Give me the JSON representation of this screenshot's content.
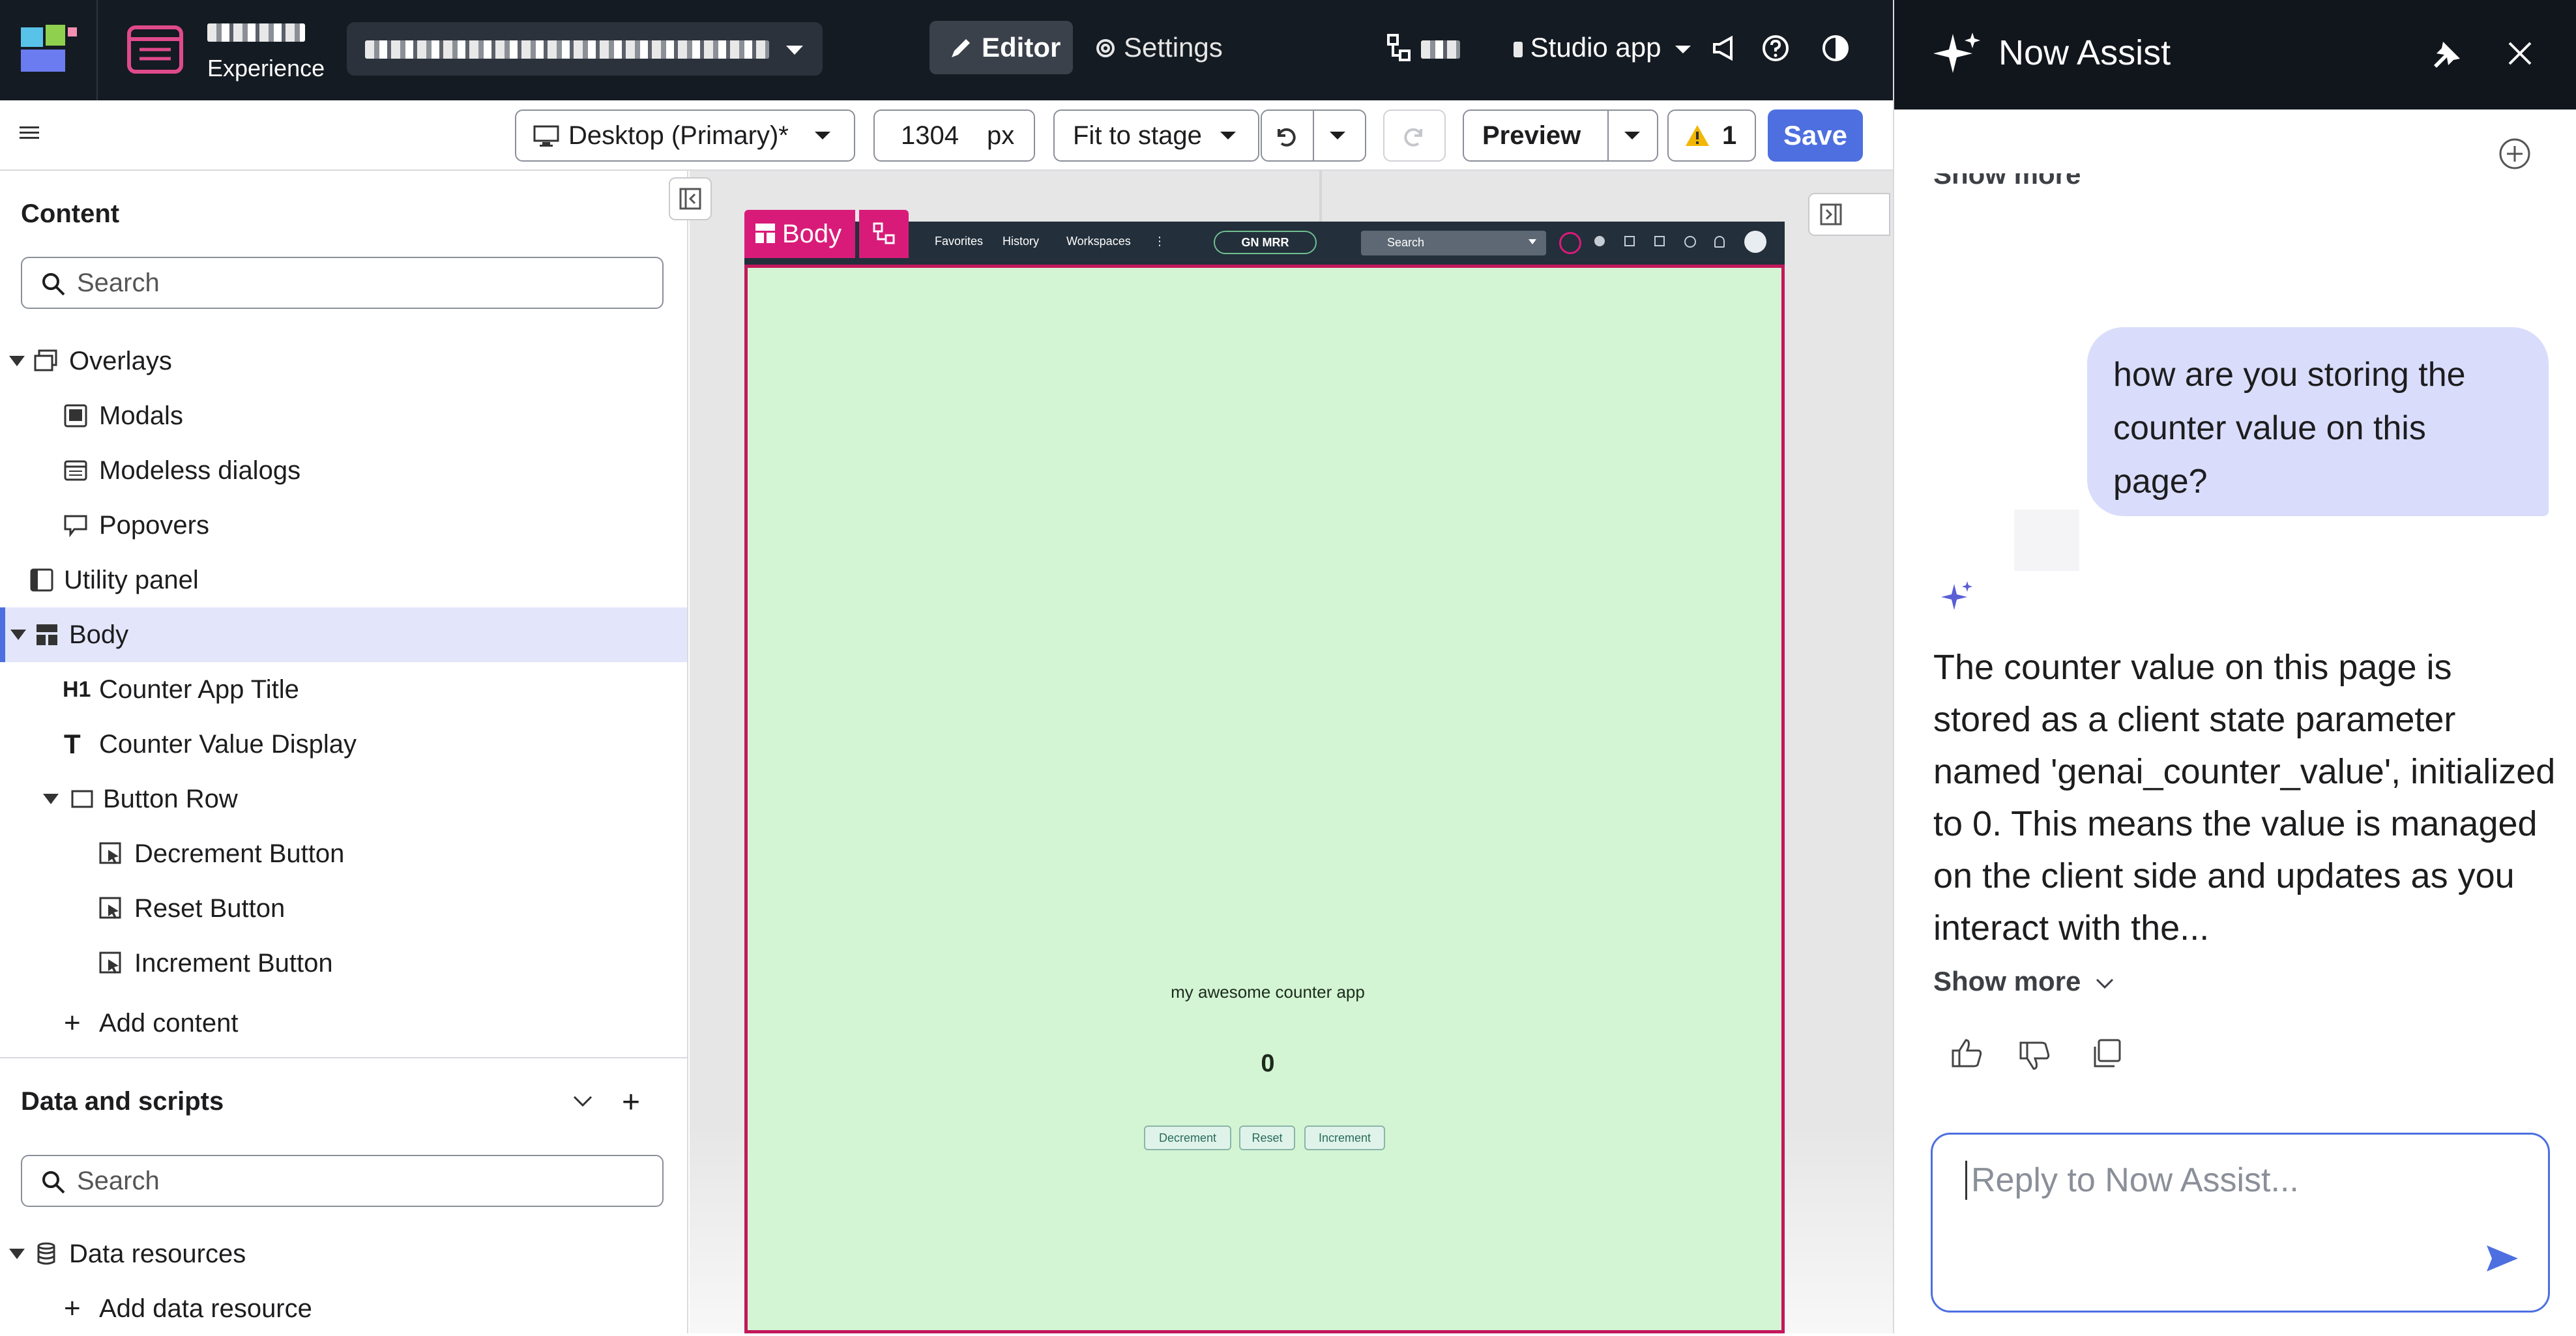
{
  "topbar": {
    "experience_label": "Experience",
    "editor_tab": "Editor",
    "settings_tab": "Settings",
    "studio_app": "Studio app"
  },
  "toolbar": {
    "viewport": "Desktop (Primary)*",
    "width_value": "1304",
    "width_unit": "px",
    "fit": "Fit to stage",
    "preview": "Preview",
    "warnings": "1",
    "save": "Save"
  },
  "content_panel": {
    "title": "Content",
    "search_placeholder": "Search",
    "tree": [
      {
        "label": "Overlays"
      },
      {
        "label": "Modals"
      },
      {
        "label": "Modeless dialogs"
      },
      {
        "label": "Popovers"
      },
      {
        "label": "Utility panel"
      },
      {
        "label": "Body"
      },
      {
        "label": "Counter App Title"
      },
      {
        "label": "Counter Value Display"
      },
      {
        "label": "Button Row"
      },
      {
        "label": "Decrement Button"
      },
      {
        "label": "Reset Button"
      },
      {
        "label": "Increment Button"
      }
    ],
    "add_content": "Add content"
  },
  "data_panel": {
    "title": "Data and scripts",
    "search_placeholder": "Search",
    "data_resources": "Data resources",
    "add_data_resource": "Add data resource"
  },
  "stage": {
    "body_tag": "Body",
    "nav_favorites": "Favorites",
    "nav_history": "History",
    "nav_workspaces": "Workspaces",
    "nav_badge": "GN MRR",
    "nav_search": "Search",
    "app_title": "my awesome counter app",
    "counter_value": "0",
    "btn_decrement": "Decrement",
    "btn_reset": "Reset",
    "btn_increment": "Increment"
  },
  "assist": {
    "title": "Now Assist",
    "top_show_more": "Show more",
    "user_message": "how are you storing the counter value on this page?",
    "ai_message": "The counter value on this page is stored as a client state parameter named 'genai_counter_value', initialized to 0. This means the value is managed on the client side and updates as you interact with the...",
    "show_more": "Show more",
    "reply_placeholder": "Reply to Now Assist..."
  }
}
